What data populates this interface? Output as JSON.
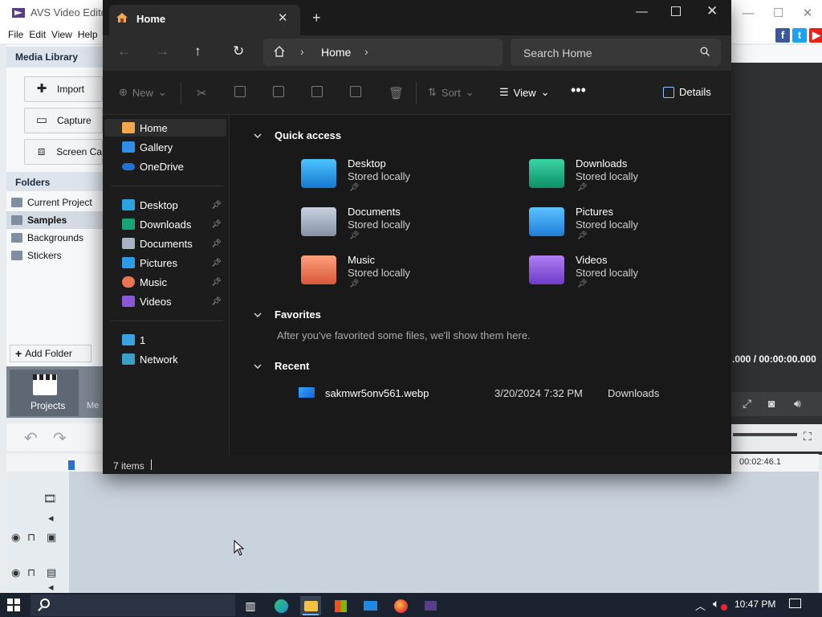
{
  "avs": {
    "title": "AVS Video Editor",
    "menu": [
      "File",
      "Edit",
      "View",
      "Help"
    ],
    "media_library_title": "Media Library",
    "buttons": {
      "import": "Import",
      "capture": "Capture",
      "screen_capture": "Screen Ca"
    },
    "folders_title": "Folders",
    "folders": [
      "Current Project",
      "Samples",
      "Backgrounds",
      "Stickers"
    ],
    "selected_folder": "Samples",
    "add_folder": "Add Folder",
    "projects_label": "Projects",
    "media_tab_partial": "Me",
    "timecode": ".000  /  00:00:00.000",
    "ruler_time": "00:02:46.1",
    "social": [
      "f",
      "t",
      "▶"
    ]
  },
  "explorer": {
    "tab_title": "Home",
    "address": {
      "current": "Home"
    },
    "search": {
      "placeholder": "Search Home"
    },
    "cmd": {
      "new": "New",
      "sort": "Sort",
      "view": "View",
      "details": "Details"
    },
    "sidebar": {
      "top": [
        {
          "label": "Home",
          "icon": "home"
        },
        {
          "label": "Gallery",
          "icon": "gallery"
        },
        {
          "label": "OneDrive",
          "icon": "cloud"
        }
      ],
      "pinned": [
        {
          "label": "Desktop"
        },
        {
          "label": "Downloads"
        },
        {
          "label": "Documents"
        },
        {
          "label": "Pictures"
        },
        {
          "label": "Music"
        },
        {
          "label": "Videos"
        }
      ],
      "devices": [
        {
          "label": "1"
        },
        {
          "label": "Network"
        }
      ]
    },
    "sections": {
      "quick_access": "Quick access",
      "favorites": "Favorites",
      "recent": "Recent"
    },
    "quick_access": [
      {
        "name": "Desktop",
        "sub": "Stored locally"
      },
      {
        "name": "Downloads",
        "sub": "Stored locally"
      },
      {
        "name": "Documents",
        "sub": "Stored locally"
      },
      {
        "name": "Pictures",
        "sub": "Stored locally"
      },
      {
        "name": "Music",
        "sub": "Stored locally"
      },
      {
        "name": "Videos",
        "sub": "Stored locally"
      }
    ],
    "favorites_msg": "After you've favorited some files, we'll show them here.",
    "recent": [
      {
        "name": "sakmwr5onv561.webp",
        "date": "3/20/2024 7:32 PM",
        "location": "Downloads"
      }
    ],
    "status": "7 items"
  },
  "taskbar": {
    "clock": "10:47 PM"
  },
  "colors": {
    "accent": "#76b9ed",
    "explorer_bg": "#202020",
    "taskbar": "#1b2330"
  }
}
